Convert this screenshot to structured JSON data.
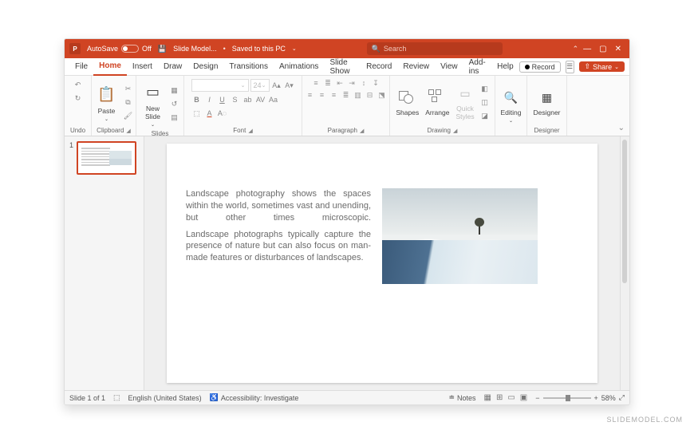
{
  "title": {
    "autosave_label": "AutoSave",
    "autosave_state": "Off",
    "doc_name": "Slide Model...",
    "saved_state": "Saved to this PC",
    "search_placeholder": "Search"
  },
  "tabs": {
    "file": "File",
    "home": "Home",
    "insert": "Insert",
    "draw": "Draw",
    "design": "Design",
    "transitions": "Transitions",
    "animations": "Animations",
    "slideshow": "Slide Show",
    "record": "Record",
    "review": "Review",
    "view": "View",
    "addins": "Add-ins",
    "help": "Help",
    "rec_btn": "Record",
    "share_btn": "Share"
  },
  "ribbon": {
    "undo": "Undo",
    "clipboard": "Clipboard",
    "paste": "Paste",
    "slides": "Slides",
    "newslide": "New\nSlide",
    "font": "Font",
    "font_size": "24",
    "paragraph": "Paragraph",
    "drawing": "Drawing",
    "shapes": "Shapes",
    "arrange": "Arrange",
    "quick": "Quick\nStyles",
    "editing": "Editing",
    "designer": "Designer",
    "designer_btn": "Designer"
  },
  "thumb": {
    "num": "1"
  },
  "slide": {
    "p1": "Landscape photography shows the spaces within the world, sometimes vast and unending, but other times microscopic.",
    "p2": "Landscape photographs typically capture the presence of nature but can also focus on man-made features or disturbances of landscapes."
  },
  "status": {
    "slide": "Slide 1 of 1",
    "lang": "English (United States)",
    "access": "Accessibility: Investigate",
    "notes": "Notes",
    "zoom": "58%"
  },
  "watermark": "SLIDEMODEL.COM"
}
